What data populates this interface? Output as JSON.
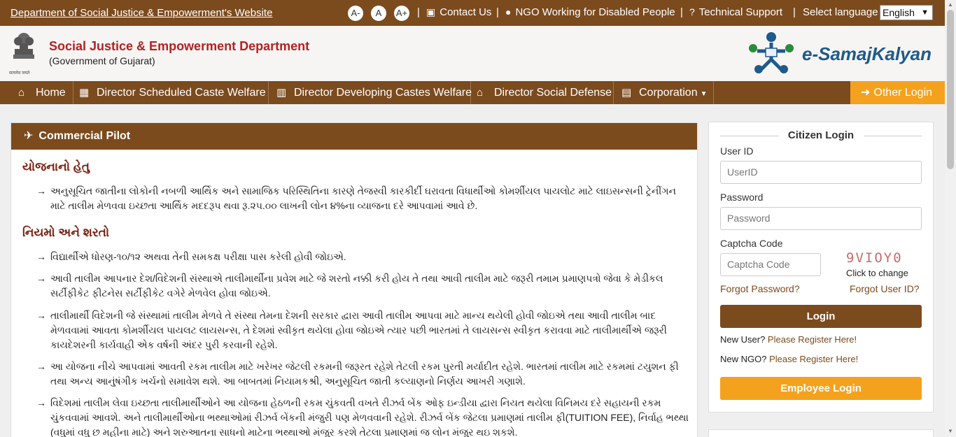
{
  "topbar": {
    "dept_link": "Department of Social Justice & Empowerment's Website",
    "font_decrease": "A-",
    "font_normal": "A",
    "font_increase": "A+",
    "contact_us": "Contact Us",
    "ngo": "NGO Working for Disabled People",
    "tech_support": "Technical Support",
    "select_language_label": "Select language",
    "language_value": "English"
  },
  "header": {
    "title": "Social Justice & Empowerment Department",
    "subtitle": "(Government of Gujarat)",
    "emblem_caption": "सत्यमेव जयते",
    "brand": "e-SamajKalyan"
  },
  "nav": {
    "items": [
      {
        "label": "Home",
        "icon": "home-icon"
      },
      {
        "label": "Director Scheduled Caste Welfare",
        "icon": "building-icon"
      },
      {
        "label": "Director Developing Castes Welfare",
        "icon": "office-icon"
      },
      {
        "label": "Director Social Defense",
        "icon": "bank-icon"
      },
      {
        "label": "Corporation",
        "icon": "institution-icon"
      }
    ],
    "other_login": "Other Login"
  },
  "scheme": {
    "title": "Commercial Pilot",
    "section1_title": "યોજનાનો હેતુ",
    "section1_items": [
      "અનુસૂચિત જાતીના લોકોની નબળી આર્થિક અને સામાજિક પરિસ્થિતિના કારણે તેજસ્વી કારકીર્દી ઘરાવતા વિધાર્થીઓ કોમર્શીયલ પાયલોટ માટે લાઇસન્સની ટ્રેનીંગન માટે તાલીમ મેળવવા ઇચ્છતા આર્થિક મદદરૂપ થવા ‍રૂ.૨૫.૦૦ લાખની લોન ૪%ના વ્યાજના દરે આપવામાં આવે છે."
    ],
    "section2_title": "નિયમો અને શરતો",
    "section2_items": [
      "વિદ્યાર્થીએ ધોરણ-૧૦/૧૨ અથવા તેની સમકક્ષ પરીક્ષા પાસ કરેલી હોવી જોઇએ.",
      "આવી તાલીમ આપનાર દેશ/વિદેશની સંસ્થાએ તાલીમાર્થીના પ્રવેશ માટે જે શરતો નક્કી કરી હોય તે તથા આવી તાલીમ માટે જરૂરી તમામ પ્રમાણપત્રો જેવા કે મેડીકલ સર્ટીફીકેટ ફીટનેસ સર્ટીફીકેટ વગેરે મેળવેલ હોવા જોઇએ.",
      "તાલીમાર્થી વિદેશની જે સંસ્થામાં તાલીમ મેળવે તે સંસ્થા તેમના દેશની સરકાર દ્વારા આવી તાલીમ આપવા માટે માન્ય થયેલી હોવી જોઇએ તથા આવી તાલીમ બાદ મેળવવામાં આવતા કોમર્શીયલ પાયલટ લાયસન્સ, તે દેશમાં સ્વીકૃત થયેલા હોવા જોઇએ ત્યાર પછી ભારતમાં તે લાયસન્સ સ્વીકૃત કરાવવા માટે તાલીમાર્થીએ જરૂરી કાયદેશરની કાર્યવાહી એક વર્ષની અંદર પુરી કરવાની રહેશે.",
      "આ યોજના નીચે આપવામાં આવતી રકમ તાલીમ માટે ખરેખર જેટલી રકમની જરૂરત રહેશે તેટલી રકમ પુરતી મર્યાદીત રહેશે. ભારતમાં તાલીમ માટે રકમમાં ટયુશન ફી તથા અન્ય આનુંષંગીક ખર્ચનો સમાવેશ થશે. આ બાબતમાં નિયામકશ્રી, અનુસૂચિત જાતી કલ્યાણનો નિર્ણય આખરી ગણાશે.",
      "વિદેશમાં તાલીમ લેવા ઇચ્છતા તાલીમાર્થીઓને આ યોજના હેઠળની રકમ ચુંકવતી વખતે રીઝર્વ બેંક ઓફ ઇન્ડીયા દ્વારા નિયત થયેલા વિનિમય દરે સહાયની રકમ ચુંકવવામાં આવશે. અને તાલીમાર્થીઓના ભથ્થાઓમાં રીઝર્વ બેંકની મંજુરી પણ મેળવવાની રહેશે. રીઝર્વ બેંક જેટલા પ્રમાણમાં તાલીમ ફી(TUITION FEE), નિર્વાહ ભથ્થા (વધુમાં વધુ છ મહીના માટે) અને શરુઆતના સાધનો માટેના ભથ્થાઓ મંજુર કરશે તેટલા પ્રમાણમાં જ લોન મંજુર થઇ શકશે."
    ]
  },
  "login": {
    "title": "Citizen Login",
    "user_id_label": "User ID",
    "user_id_placeholder": "UserID",
    "password_label": "Password",
    "password_placeholder": "Password",
    "captcha_label": "Captcha Code",
    "captcha_placeholder": "Captcha Code",
    "captcha_text": "9VIOY0",
    "captcha_change": "Click to change",
    "forgot_password": "Forgot Password?",
    "forgot_user_id": "Forgot User ID?",
    "login_button": "Login",
    "new_user_text": "New User?",
    "new_user_link": "Please Register Here!",
    "new_ngo_text": "New NGO?",
    "new_ngo_link": "Please Register Here!",
    "employee_login": "Employee Login"
  },
  "colors": {
    "brand_brown": "#7b4b1e",
    "accent_orange": "#f4a21d",
    "title_red": "#b22222"
  }
}
